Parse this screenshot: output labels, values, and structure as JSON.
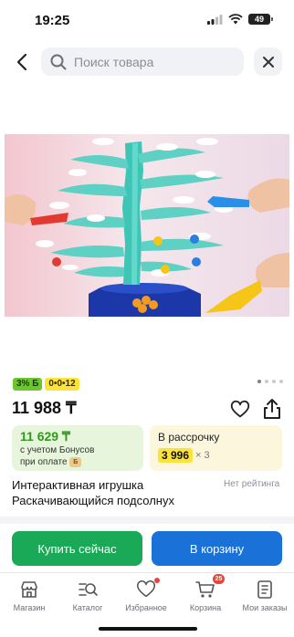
{
  "status_bar": {
    "time": "19:25",
    "battery": "49"
  },
  "search": {
    "placeholder": "Поиск товара",
    "value": ""
  },
  "gallery": {
    "slides": 4,
    "active_slide": 1
  },
  "badges": {
    "cashback": "3% Б",
    "installment": "0•0•12"
  },
  "product": {
    "price": "11 988 ₸",
    "bonus_price": "11 629 ₸",
    "bonus_note_line1": "с учетом Бонусов",
    "bonus_note_line2": "при оплате",
    "bonus_coin": "Б",
    "installment_title": "В рассрочку",
    "installment_amount": "3 996",
    "installment_multiplier": "× 3",
    "title": "Интерактивная игрушка Раскачивающийся подсолнух",
    "rating": "Нет рейтинга"
  },
  "actions": {
    "buy_now": "Купить сейчас",
    "add_to_cart": "В корзину"
  },
  "tabbar": {
    "items": [
      {
        "label": "Магазин",
        "icon": "shop-icon"
      },
      {
        "label": "Каталог",
        "icon": "catalog-search-icon"
      },
      {
        "label": "Избранное",
        "icon": "heart-icon"
      },
      {
        "label": "Корзина",
        "icon": "cart-icon"
      },
      {
        "label": "Мои заказы",
        "icon": "orders-icon"
      }
    ],
    "cart_count": "25"
  },
  "colors": {
    "green_button": "#19a957",
    "blue_button": "#1a72d8",
    "bonus_green": "#2f9a1c",
    "highlight_yellow": "#fbe33a",
    "badge_red": "#e8443a"
  }
}
